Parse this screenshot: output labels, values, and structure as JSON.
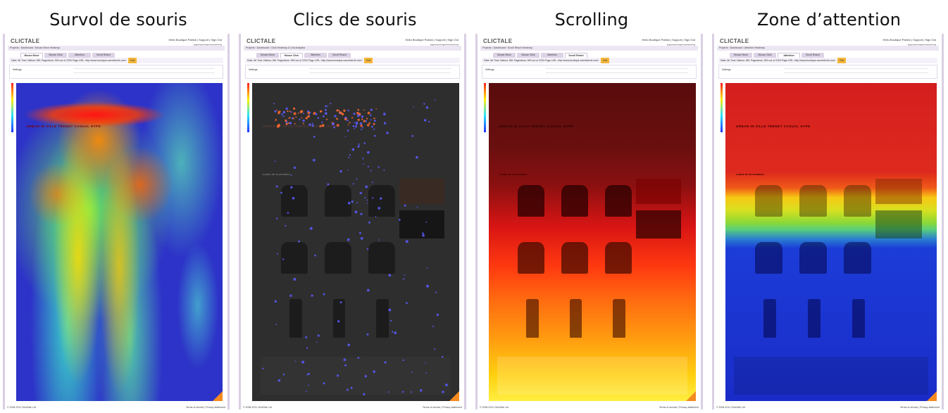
{
  "panels": [
    {
      "id": "survol",
      "title": "Survol de souris",
      "active_tab": 0,
      "crumb": "Projects › Dashboard › Mouse Move Heatmap"
    },
    {
      "id": "clics",
      "title": "Clics de souris",
      "active_tab": 1,
      "crumb": "Projects › Dashboard › Click Heatmap & Link Analytics"
    },
    {
      "id": "scrolling",
      "title": "Scrolling",
      "active_tab": 3,
      "crumb": "Projects › Dashboard › Scroll Reach Heatmap"
    },
    {
      "id": "attention",
      "title": "Zone d’attention",
      "active_tab": 2,
      "crumb": "Projects › Dashboard › Attention Heatmap"
    }
  ],
  "app": {
    "logo": "CLICTALE",
    "hello": "Hello Boutique Patrick | Support | Sign Out",
    "view_project": "View project:",
    "project_name": "Boutique Carnet de Vie",
    "tabs": [
      "Mouse Move",
      "Mouse Click",
      "Attention",
      "Scroll Reach"
    ],
    "stats": "Date: All Time   Visitors: 881   Pageviews: 999 out of 2253   Page URL: http://www.boutique.carnetdevie.com/",
    "go": "Edit",
    "settings": "Settings",
    "footer_left": "© 2006-2011 ClickTale Ltd",
    "footer_right": "Terms of service | Privacy statement"
  },
  "site": {
    "banner": "URBAN IN   VILLE TRENDY   CASUAL HYPE",
    "looks": "Looks de la semaine..."
  },
  "colors": {
    "frame": "#d9cfe3",
    "accent": "#f58a1f"
  }
}
